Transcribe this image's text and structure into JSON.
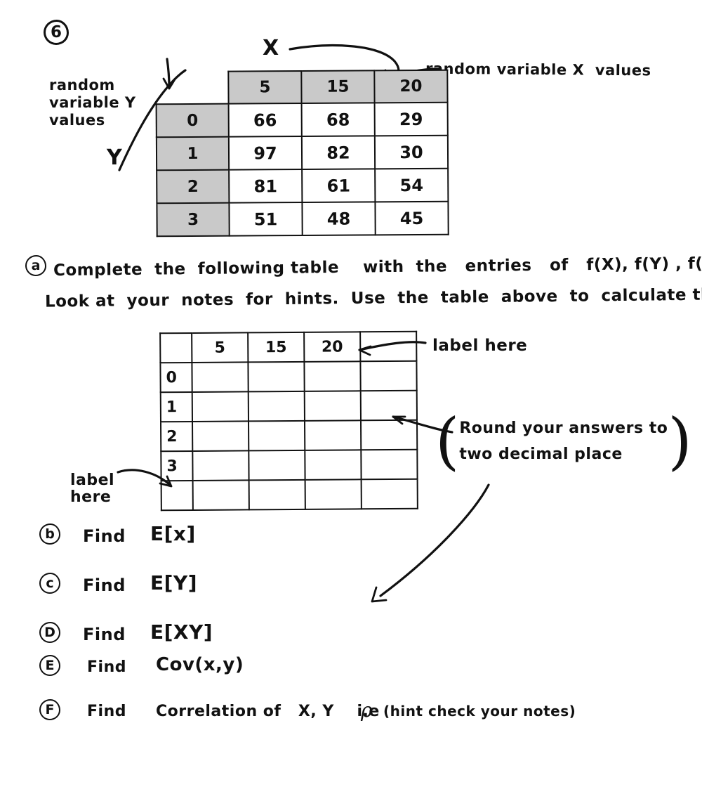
{
  "page": {
    "problem_number": "6",
    "background": "#ffffff",
    "ink_color": "#111111",
    "shade_color": "#c9c9c9"
  },
  "annotations": {
    "x_label": "X",
    "y_label": "Y",
    "x_values_note": "random variable X  values",
    "y_values_note_line1": "random",
    "y_values_note_line2": "variable Y",
    "y_values_note_line3": "values",
    "label_here_top": "label here",
    "label_here_bottom_line1": "label",
    "label_here_bottom_line2": "here",
    "round_note_line1": "Round your answers to",
    "round_note_line2": "two decimal place"
  },
  "data_table": {
    "column_headers": [
      "5",
      "15",
      "20"
    ],
    "row_labels": [
      "0",
      "1",
      "2",
      "3"
    ],
    "rows": [
      [
        "66",
        "68",
        "29"
      ],
      [
        "97",
        "82",
        "30"
      ],
      [
        "81",
        "61",
        "54"
      ],
      [
        "51",
        "48",
        "45"
      ]
    ]
  },
  "blank_table": {
    "column_headers": [
      "5",
      "15",
      "20",
      ""
    ],
    "row_labels": [
      "0",
      "1",
      "2",
      "3",
      ""
    ],
    "rows": [
      [
        "",
        "",
        "",
        ""
      ],
      [
        "",
        "",
        "",
        ""
      ],
      [
        "",
        "",
        "",
        ""
      ],
      [
        "",
        "",
        "",
        ""
      ],
      [
        "",
        "",
        "",
        ""
      ]
    ]
  },
  "questions": [
    {
      "marker": "a",
      "line1": "Complete  the  following table    with  the   entries   of   f(X), f(Y) , f(x,y)",
      "line2": "Look at  your  notes  for  hints.  Use  the  table  above  to  calculate the values"
    },
    {
      "marker": "b",
      "verb": "Find",
      "expression": "E[x]"
    },
    {
      "marker": "c",
      "verb": "Find",
      "expression": "E[Y]"
    },
    {
      "marker": "D",
      "verb": "Find",
      "expression": "E[XY]"
    },
    {
      "marker": "E",
      "verb": "Find",
      "expression": "Cov(x,y)"
    },
    {
      "marker": "F",
      "verb": "Find",
      "expression_prefix": "Correlation of   X, Y    i.e",
      "rho": "ρ",
      "expression_suffix": "(hint check your notes)"
    }
  ]
}
